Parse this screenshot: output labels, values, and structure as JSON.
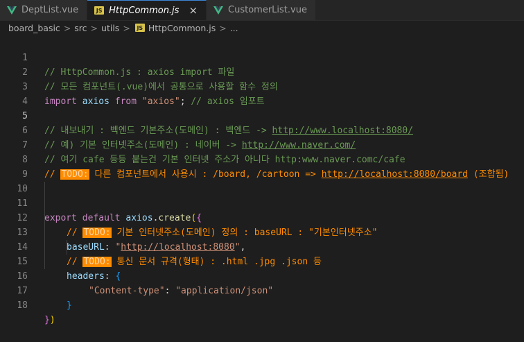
{
  "tabs": [
    {
      "label": "DeptList.vue",
      "icon": "vue-icon",
      "active": false
    },
    {
      "label": "HttpCommon.js",
      "icon": "js-icon",
      "active": true
    },
    {
      "label": "CustomerList.vue",
      "icon": "vue-icon",
      "active": false
    }
  ],
  "js_icon_text": "JS",
  "close_glyph": "×",
  "breadcrumb": {
    "items": [
      "board_basic",
      "src",
      "utils",
      "HttpCommon.js",
      "..."
    ],
    "sep": ">"
  },
  "line_numbers": [
    "1",
    "2",
    "3",
    "4",
    "5",
    "6",
    "7",
    "8",
    "9",
    "10",
    "11",
    "12",
    "13",
    "14",
    "15",
    "16",
    "17",
    "18"
  ],
  "code": {
    "l1": "// HttpCommon.js : axios import 파일",
    "l2": "// 모든 컴포넌트(.vue)에서 공통으로 사용할 함수 정의",
    "l3_import": "import",
    "l3_axios": "axios",
    "l3_from": "from",
    "l3_str": "\"axios\"",
    "l3_semi": ";",
    "l3_comment": "// axios 임포트",
    "l5_a": "// 내보내기 : 벡엔드 기본주소(도메인) : 벡엔드 -> ",
    "l5_url": "http://www.localhost:8080/",
    "l6_a": "// 예) 기본 인터넷주소(도메인) : 네이버 -> ",
    "l6_url": "http://www.naver.com/",
    "l7": "// 여기 cafe 등등 붙는건 기본 인터넷 주소가 아니다 http:www.naver.comc/cafe",
    "l8_slash": "// ",
    "todo": "TODO:",
    "l8_rest": " 다른 컴포넌트에서 사용시 : /board, /cartoon => ",
    "l8_url": "http://localhost:8080/board",
    "l8_tail": " (조합됨)",
    "l11_export": "export",
    "l11_default": "default",
    "l11_axios": "axios",
    "l11_dot": ".",
    "l11_create": "create",
    "l11_paren": "(",
    "l11_brace": "{",
    "l12_slash": "// ",
    "l12_rest": " 기본 인터넷주소(도메인) 정의 : baseURL : \"기본인터넷주소\"",
    "l13_key": "baseURL",
    "l13_colon": ": ",
    "l13_q1": "\"",
    "l13_url": "http://localhost:8080",
    "l13_q2": "\"",
    "l13_comma": ",",
    "l14_slash": "// ",
    "l14_rest": " 통신 문서 규격(형태) : .html .jpg .json 등",
    "l15_key": "headers",
    "l15_colon": ": ",
    "l15_brace": "{",
    "l16_key": "\"Content-type\"",
    "l16_colon": ": ",
    "l16_val": "\"application/json\"",
    "l17_brace": "}",
    "l18_brace": "}",
    "l18_paren": ")"
  }
}
